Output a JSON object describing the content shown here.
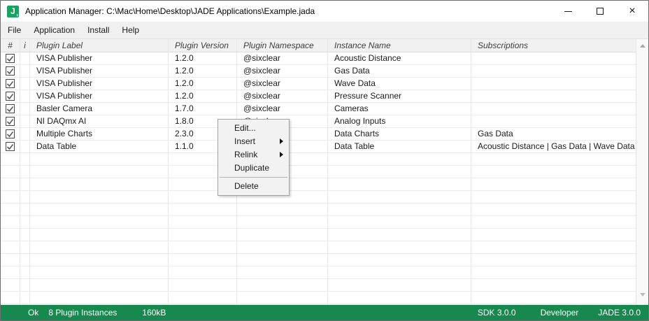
{
  "window": {
    "title": "Application Manager: C:\\Mac\\Home\\Desktop\\JADE Applications\\Example.jada",
    "icon_letter": "J",
    "icon_comma": ","
  },
  "icons": {
    "app": "jade-logo-icon",
    "minimize": "horizontal-bar",
    "maximize": "hollow-square",
    "close": "x-cross",
    "submenu_arrow": "right-triangle",
    "scrollbar_up": "up-triangle",
    "scrollbar_down": "down-triangle",
    "checkbox_check": "check-mark"
  },
  "colors": {
    "status_bar_green": "#17894f",
    "icon_green": "#1aa260",
    "menubar_bg": "#f0f0f0",
    "header_bg": "#f1f1f1"
  },
  "menu_bar": {
    "items": [
      "File",
      "Application",
      "Install",
      "Help"
    ]
  },
  "table": {
    "headers": [
      "#",
      "i",
      "Plugin Label",
      "Plugin Version",
      "Plugin Namespace",
      "Instance Name",
      "Subscriptions"
    ],
    "rows": [
      {
        "checked": true,
        "label": "VISA Publisher",
        "version": "1.2.0",
        "namespace": "@sixclear",
        "instance": "Acoustic Distance",
        "subscriptions": ""
      },
      {
        "checked": true,
        "label": "VISA Publisher",
        "version": "1.2.0",
        "namespace": "@sixclear",
        "instance": "Gas Data",
        "subscriptions": ""
      },
      {
        "checked": true,
        "label": "VISA Publisher",
        "version": "1.2.0",
        "namespace": "@sixclear",
        "instance": "Wave Data",
        "subscriptions": ""
      },
      {
        "checked": true,
        "label": "VISA Publisher",
        "version": "1.2.0",
        "namespace": "@sixclear",
        "instance": "Pressure Scanner",
        "subscriptions": ""
      },
      {
        "checked": true,
        "label": "Basler Camera",
        "version": "1.7.0",
        "namespace": "@sixclear",
        "instance": "Cameras",
        "subscriptions": ""
      },
      {
        "checked": true,
        "label": "NI DAQmx AI",
        "version": "1.8.0",
        "namespace": "@sixclear",
        "instance": "Analog Inputs",
        "subscriptions": ""
      },
      {
        "checked": true,
        "label": "Multiple Charts",
        "version": "2.3.0",
        "namespace": "",
        "instance": "Data Charts",
        "subscriptions": "Gas Data"
      },
      {
        "checked": true,
        "label": "Data Table",
        "version": "1.1.0",
        "namespace": "",
        "instance": "Data Table",
        "subscriptions": "Acoustic Distance | Gas Data | Wave Data"
      }
    ],
    "empty_rows": 13
  },
  "context_menu": {
    "items": [
      {
        "label": "Edit...",
        "submenu": false
      },
      {
        "label": "Insert",
        "submenu": true
      },
      {
        "label": "Relink",
        "submenu": true
      },
      {
        "label": "Duplicate",
        "submenu": false
      },
      {
        "separator": true
      },
      {
        "label": "Delete",
        "submenu": false
      }
    ]
  },
  "status_bar": {
    "left": [
      "Ok",
      "8 Plugin Instances",
      "160kB"
    ],
    "right": [
      "SDK 3.0.0",
      "Developer",
      "JADE 3.0.0"
    ]
  }
}
